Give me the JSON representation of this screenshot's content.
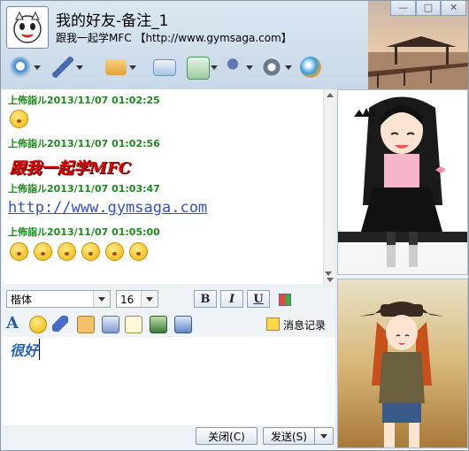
{
  "window": {
    "title": "我的好友-备注_1",
    "subtitle": "跟我一起学MFC 【http://www.gymsaga.com】",
    "controls": {
      "minimize": "—",
      "maximize": "□",
      "close": "✕"
    }
  },
  "toolbar": {
    "items": [
      {
        "name": "video-icon",
        "color": "#3a86d6"
      },
      {
        "name": "microphone-icon",
        "color": "#4a6ab0"
      },
      {
        "name": "folder-transfer-icon",
        "color": "#e2a23a"
      },
      {
        "name": "mail-icon",
        "color": "#6a90c8"
      },
      {
        "name": "add-member-icon",
        "color": "#3aa05a"
      },
      {
        "name": "group-chat-icon",
        "color": "#5a7ab0"
      },
      {
        "name": "settings-icon",
        "color": "#6a7a90"
      },
      {
        "name": "app-icon",
        "color": "#3aa0d8"
      }
    ]
  },
  "messages": [
    {
      "header": "上佈詣ル2013/11/07 01:02:25",
      "type": "emoticons",
      "count": 1
    },
    {
      "header": "上佈詣ル2013/11/07 01:02:56",
      "type": "styled",
      "text": "跟我一起学MFC"
    },
    {
      "header": "上佈詣ル2013/11/07 01:03:47",
      "type": "link",
      "text": "http://www.gymsaga.com"
    },
    {
      "header": "上佈詣ル2013/11/07 01:05:00",
      "type": "emoticons",
      "count": 6
    }
  ],
  "format_bar": {
    "font": "楷体",
    "size": "16",
    "bold": "B",
    "italic": "I",
    "underline": "U"
  },
  "tools": {
    "items": [
      "font-color-icon",
      "smiley-icon",
      "magic-hat-icon",
      "thumbs-up-icon",
      "voice-icon",
      "note-icon",
      "picture-icon",
      "screen-capture-icon"
    ],
    "history_label": "消息记录"
  },
  "input": {
    "text": "很好"
  },
  "buttons": {
    "close": "关闭(C)",
    "send": "发送(S)"
  },
  "colors": {
    "accent_green": "#1a8a1a",
    "red_text": "#e00000",
    "link_blue": "#3050c8"
  }
}
